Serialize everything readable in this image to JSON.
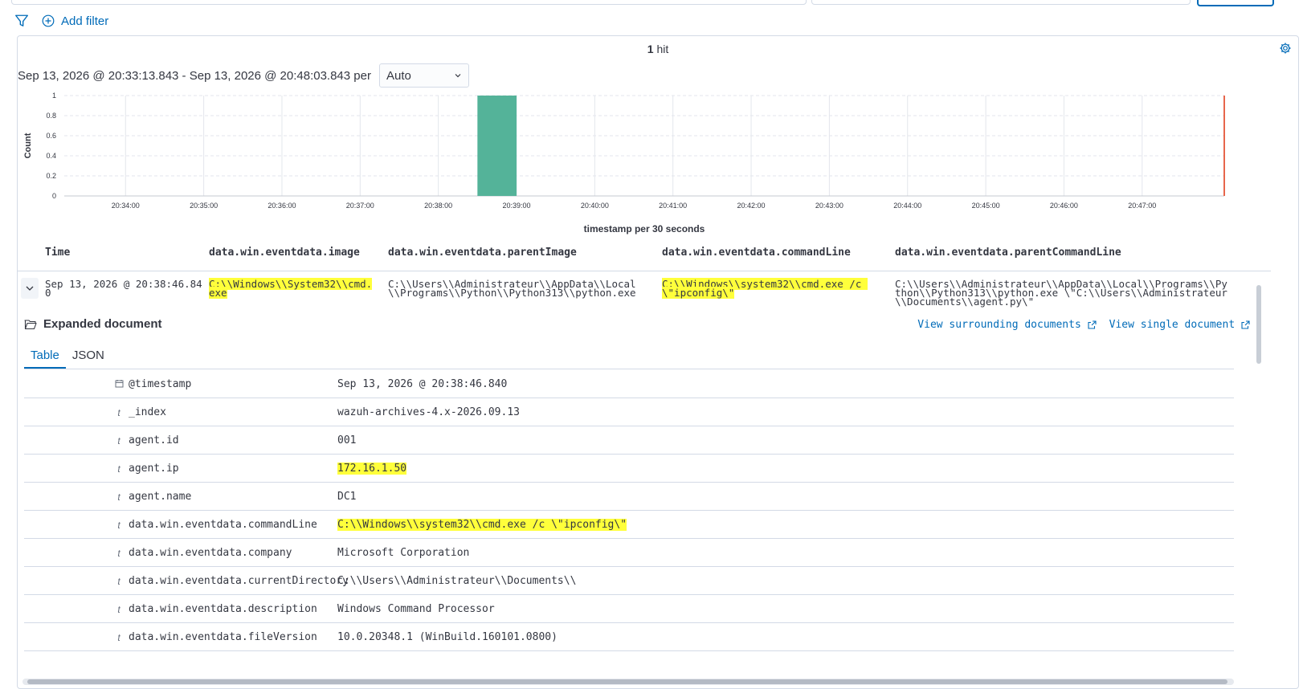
{
  "filterbar": {
    "add_filter": "Add filter"
  },
  "hits": {
    "count": "1",
    "label": "hit"
  },
  "date_range": {
    "text": "Sep 13, 2026 @ 20:33:13.843 - Sep 13, 2026 @ 20:48:03.843 per",
    "interval": "Auto"
  },
  "chart_data": {
    "type": "bar",
    "ylabel": "Count",
    "xlabel": "timestamp per 30 seconds",
    "ylim": [
      0,
      1
    ],
    "yticks": [
      "0",
      "0.2",
      "0.4",
      "0.6",
      "0.8",
      "1"
    ],
    "xticks": [
      "20:34:00",
      "20:35:00",
      "20:36:00",
      "20:37:00",
      "20:38:00",
      "20:39:00",
      "20:40:00",
      "20:41:00",
      "20:42:00",
      "20:43:00",
      "20:44:00",
      "20:45:00",
      "20:46:00",
      "20:47:00"
    ],
    "bars": [
      {
        "start": "20:38:30",
        "end": "20:39:00",
        "value": 1
      }
    ],
    "bar_color": "#54b399",
    "now_line_color": "#e7664c",
    "grid": true
  },
  "table": {
    "headers": [
      "Time",
      "data.win.eventdata.image",
      "data.win.eventdata.parentImage",
      "data.win.eventdata.commandLine",
      "data.win.eventdata.parentCommandLine"
    ],
    "row": {
      "time": "Sep 13, 2026 @ 20:38:46.840",
      "image": "C:\\\\Windows\\\\System32\\\\cmd.exe",
      "parentImage": "C:\\\\Users\\\\Administrateur\\\\AppData\\\\Local\\\\Programs\\\\Python\\\\Python313\\\\python.exe",
      "commandLine": "C:\\\\Windows\\\\system32\\\\cmd.exe /c \\\"ipconfig\\\"",
      "parentCommandLine": "C:\\\\Users\\\\Administrateur\\\\AppData\\\\Local\\\\Programs\\\\Python\\\\Python313\\\\python.exe \\\"C:\\\\Users\\\\Administrateur\\\\Documents\\\\agent.py\\\""
    }
  },
  "expanded": {
    "title": "Expanded document",
    "view_surrounding": "View surrounding documents",
    "view_single": "View single document",
    "tabs": [
      "Table",
      "JSON"
    ],
    "fields": [
      {
        "type": "cal",
        "name": "@timestamp",
        "value": "Sep 13, 2026 @ 20:38:46.840",
        "highlight": false
      },
      {
        "type": "t",
        "name": "_index",
        "value": "wazuh-archives-4.x-2026.09.13",
        "highlight": false
      },
      {
        "type": "t",
        "name": "agent.id",
        "value": "001",
        "highlight": false
      },
      {
        "type": "t",
        "name": "agent.ip",
        "value": "172.16.1.50",
        "highlight": true
      },
      {
        "type": "t",
        "name": "agent.name",
        "value": "DC1",
        "highlight": false
      },
      {
        "type": "t",
        "name": "data.win.eventdata.commandLine",
        "value": "C:\\\\Windows\\\\system32\\\\cmd.exe /c \\\"ipconfig\\\"",
        "highlight": true
      },
      {
        "type": "t",
        "name": "data.win.eventdata.company",
        "value": "Microsoft Corporation",
        "highlight": false
      },
      {
        "type": "t",
        "name": "data.win.eventdata.currentDirectory",
        "value": "C:\\\\Users\\\\Administrateur\\\\Documents\\\\",
        "highlight": false
      },
      {
        "type": "t",
        "name": "data.win.eventdata.description",
        "value": "Windows Command Processor",
        "highlight": false
      },
      {
        "type": "t",
        "name": "data.win.eventdata.fileVersion",
        "value": "10.0.20348.1 (WinBuild.160101.0800)",
        "highlight": false
      }
    ]
  }
}
